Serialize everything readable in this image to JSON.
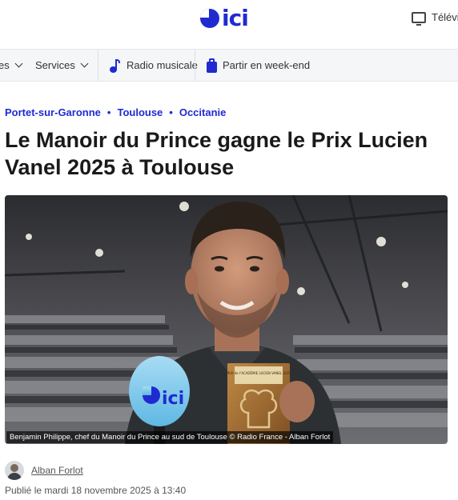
{
  "header": {
    "logo_text": "ici",
    "tv_label": "Télévis"
  },
  "nav": {
    "items": [
      {
        "label": "es"
      },
      {
        "label": "Services"
      },
      {
        "label": "Radio musicale"
      },
      {
        "label": "Partir en week-end"
      }
    ]
  },
  "breadcrumb": [
    "Portet-sur-Garonne",
    "Toulouse",
    "Occitanie"
  ],
  "breadcrumb_sep": "•",
  "article": {
    "title": "Le Manoir du Prince gagne le Prix Lucien Vanel 2025 à Toulouse",
    "photo_caption": "Benjamin Philippe, chef du Manoir du Prince au sud de Toulouse © Radio France - Alban Forlot",
    "mic_logo_text": "ici",
    "trophy_text": "PRIX de l'ACADÉMIE LUCIEN VANEL 2025",
    "author": "Alban Forlot",
    "published": "Publié le mardi 18 novembre 2025 à 13:40"
  },
  "colors": {
    "accent": "#1f2bd1",
    "text": "#1a1a1a",
    "nav_bg": "#f5f6f8"
  },
  "icons": {
    "radio": "music-note-icon",
    "weekend": "suitcase-icon",
    "tv": "tv-icon"
  }
}
